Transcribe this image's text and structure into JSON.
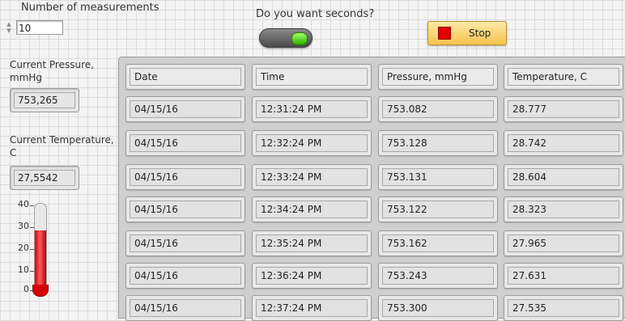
{
  "measurements": {
    "label": "Number of measurements",
    "value": "10"
  },
  "seconds_toggle": {
    "label": "Do you want seconds?",
    "state": "on"
  },
  "stop": {
    "label": "Stop"
  },
  "pressure": {
    "label_line1": "Current Pressure,",
    "label_line2": "mmHg",
    "value": "753,265"
  },
  "temperature": {
    "label_line1": "Current Temperature,",
    "label_line2": "C",
    "value": "27,5542"
  },
  "thermometer": {
    "ticks": [
      "40",
      "30",
      "20",
      "10",
      "0"
    ],
    "level": 27.55,
    "min": 0,
    "max": 40,
    "fill_color": "#d40000"
  },
  "table": {
    "headers": [
      "Date",
      "Time",
      "Pressure, mmHg",
      "Temperature, C"
    ],
    "rows": [
      [
        "04/15/16",
        "12:31:24 PM",
        "753.082",
        "28.777"
      ],
      [
        "04/15/16",
        "12:32:24 PM",
        "753.128",
        "28.742"
      ],
      [
        "04/15/16",
        "12:33:24 PM",
        "753.131",
        "28.604"
      ],
      [
        "04/15/16",
        "12:34:24 PM",
        "753.122",
        "28.323"
      ],
      [
        "04/15/16",
        "12:35:24 PM",
        "753.162",
        "27.965"
      ],
      [
        "04/15/16",
        "12:36:24 PM",
        "753.243",
        "27.631"
      ],
      [
        "04/15/16",
        "12:37:24 PM",
        "753.300",
        "27.535"
      ]
    ]
  }
}
